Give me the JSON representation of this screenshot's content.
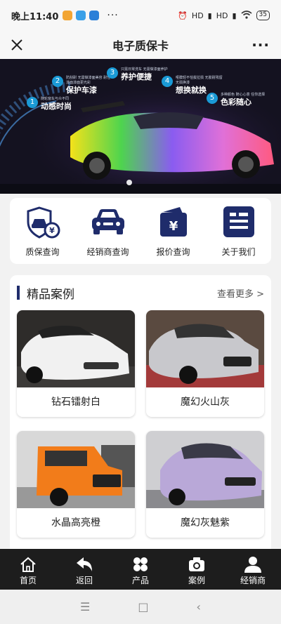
{
  "status_bar": {
    "time": "晚上11:40",
    "dots": "···",
    "signal1": "HD",
    "signal2": "HD",
    "battery": "35"
  },
  "nav": {
    "title": "电子质保卡",
    "more": "···"
  },
  "banner": {
    "features": [
      {
        "num": "1",
        "sub": "随轮窗车与众不同",
        "main": "动感时尚"
      },
      {
        "num": "2",
        "sub": "防刮耐 无需做漆面美容 耐性漆面漆面更光彩",
        "main": "保护车漆"
      },
      {
        "num": "3",
        "sub": "只需日常洗车 无需做漆面养护",
        "main": "养护便捷"
      },
      {
        "num": "4",
        "sub": "哑膜轻不怕拔拉损 无胶耐残留 无损换漆",
        "main": "想换就换"
      },
      {
        "num": "5",
        "sub": "多种颜色 随心心意 任你选择",
        "main": "色彩随心"
      }
    ]
  },
  "quick_links": [
    {
      "label": "质保查询",
      "icon": "shield-car-yen-icon"
    },
    {
      "label": "经销商查询",
      "icon": "car-front-icon"
    },
    {
      "label": "报价查询",
      "icon": "wallet-yen-icon"
    },
    {
      "label": "关于我们",
      "icon": "info-doc-icon"
    }
  ],
  "cases": {
    "title": "精品案例",
    "more": "查看更多 >",
    "items": [
      {
        "caption": "钻石镭射白"
      },
      {
        "caption": "魔幻火山灰"
      },
      {
        "caption": "水晶高亮橙"
      },
      {
        "caption": "魔幻灰魅紫"
      }
    ]
  },
  "tabbar": [
    {
      "label": "首页",
      "icon": "home-icon"
    },
    {
      "label": "返回",
      "icon": "back-arrow-icon"
    },
    {
      "label": "产品",
      "icon": "grid-icon"
    },
    {
      "label": "案例",
      "icon": "camera-icon"
    },
    {
      "label": "经销商",
      "icon": "user-icon"
    }
  ],
  "system_nav": {
    "menu": "☰",
    "home": "□",
    "back": "‹"
  },
  "colors": {
    "brand_navy": "#1f2c6b",
    "accent_blue": "#1a9ad6",
    "tabbar_bg": "#1d1d1d"
  }
}
